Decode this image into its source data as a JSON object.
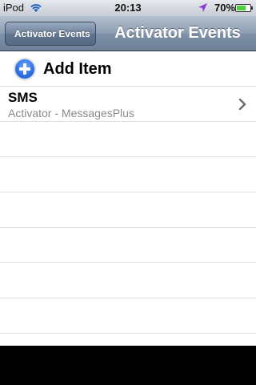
{
  "status_bar": {
    "carrier": "iPod",
    "time": "20:13",
    "battery_percent": "70%",
    "battery_level": 0.7,
    "wifi_icon": "wifi-icon",
    "location_icon": "location-arrow-icon",
    "battery_icon": "battery-icon"
  },
  "nav_bar": {
    "back_label": "Activator Events",
    "title": "Activator Events"
  },
  "table": {
    "add_item": {
      "icon": "add-circle-icon",
      "label": "Add Item"
    },
    "rows": [
      {
        "title": "SMS",
        "subtitle": "Activator - MessagesPlus",
        "accessory": "chevron-right-icon"
      }
    ]
  },
  "colors": {
    "nav_bar": "#8d9db3",
    "add_icon": "#2c6fe0",
    "battery_fill": "#4cd03b",
    "location_arrow": "#8a3ad6",
    "subtitle_text": "#8a8a8a"
  }
}
